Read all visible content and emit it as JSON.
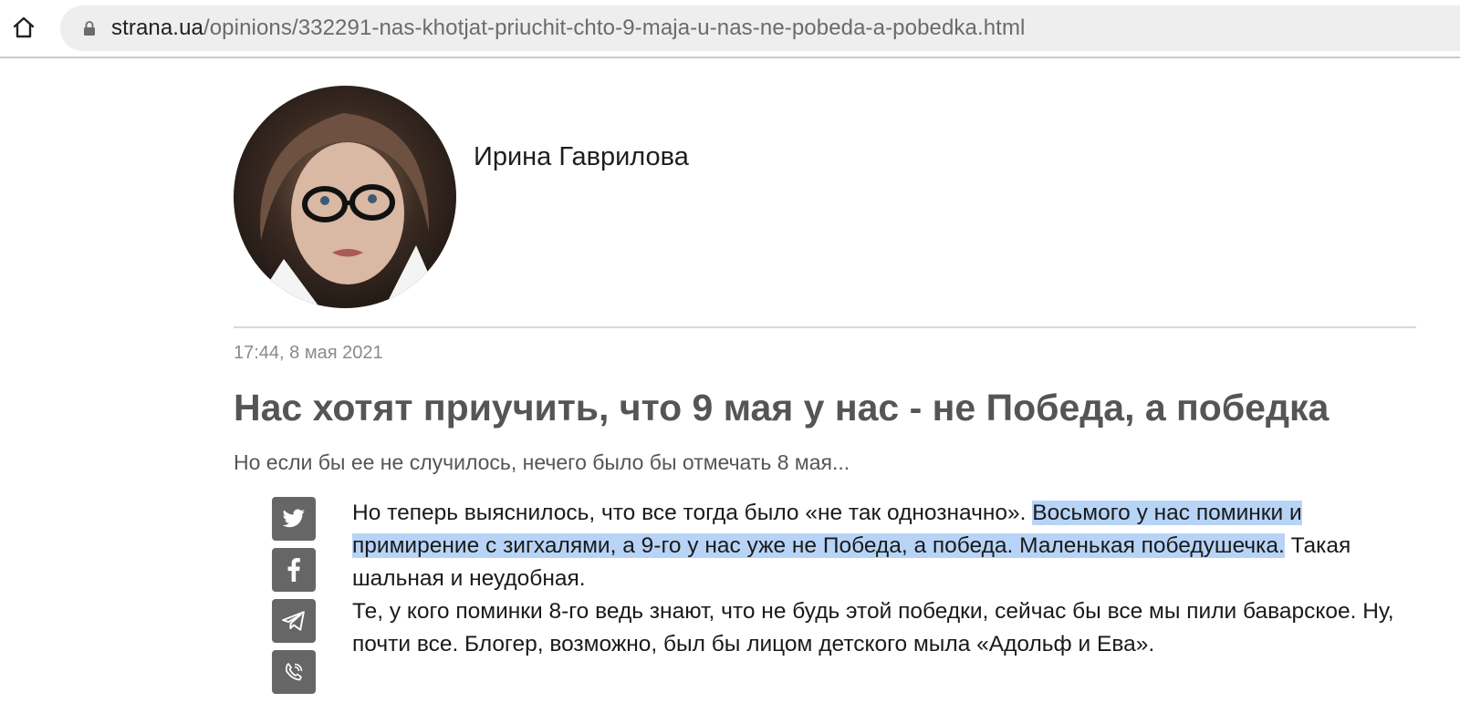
{
  "browser": {
    "url_domain": "strana.ua",
    "url_path": "/opinions/332291-nas-khotjat-priuchit-chto-9-maja-u-nas-ne-pobeda-a-pobedka.html",
    "home_icon": "home-icon",
    "lock_icon": "lock-icon"
  },
  "article": {
    "author": "Ирина Гаврилова",
    "timestamp": "17:44, 8 мая 2021",
    "title": "Нас хотят приучить, что 9 мая у нас - не Победа, а победка",
    "lead": "Но если бы ее не случилось, нечего было бы отмечать 8 мая...",
    "paragraph1_plain": "Но теперь выяснилось, что все тогда было «не так однозначно». ",
    "paragraph1_selected": "Восьмого у нас поминки и примирение с зигхалями, а 9-го у нас уже не Победа, а победа. Маленькая победушечка.",
    "paragraph1_tail": " Такая шальная и неудобная.",
    "paragraph2": "Те, у кого поминки 8-го ведь знают, что не будь этой победки, сейчас бы все мы пили баварское. Ну, почти все. Блогер, возможно, был бы лицом детского мыла «Адольф и Ева».",
    "share_buttons": [
      "twitter-icon",
      "facebook-icon",
      "telegram-icon",
      "viber-icon"
    ],
    "colors": {
      "selection": "#b7d4f7",
      "share_bg": "#666666",
      "headline": "#555555"
    }
  }
}
